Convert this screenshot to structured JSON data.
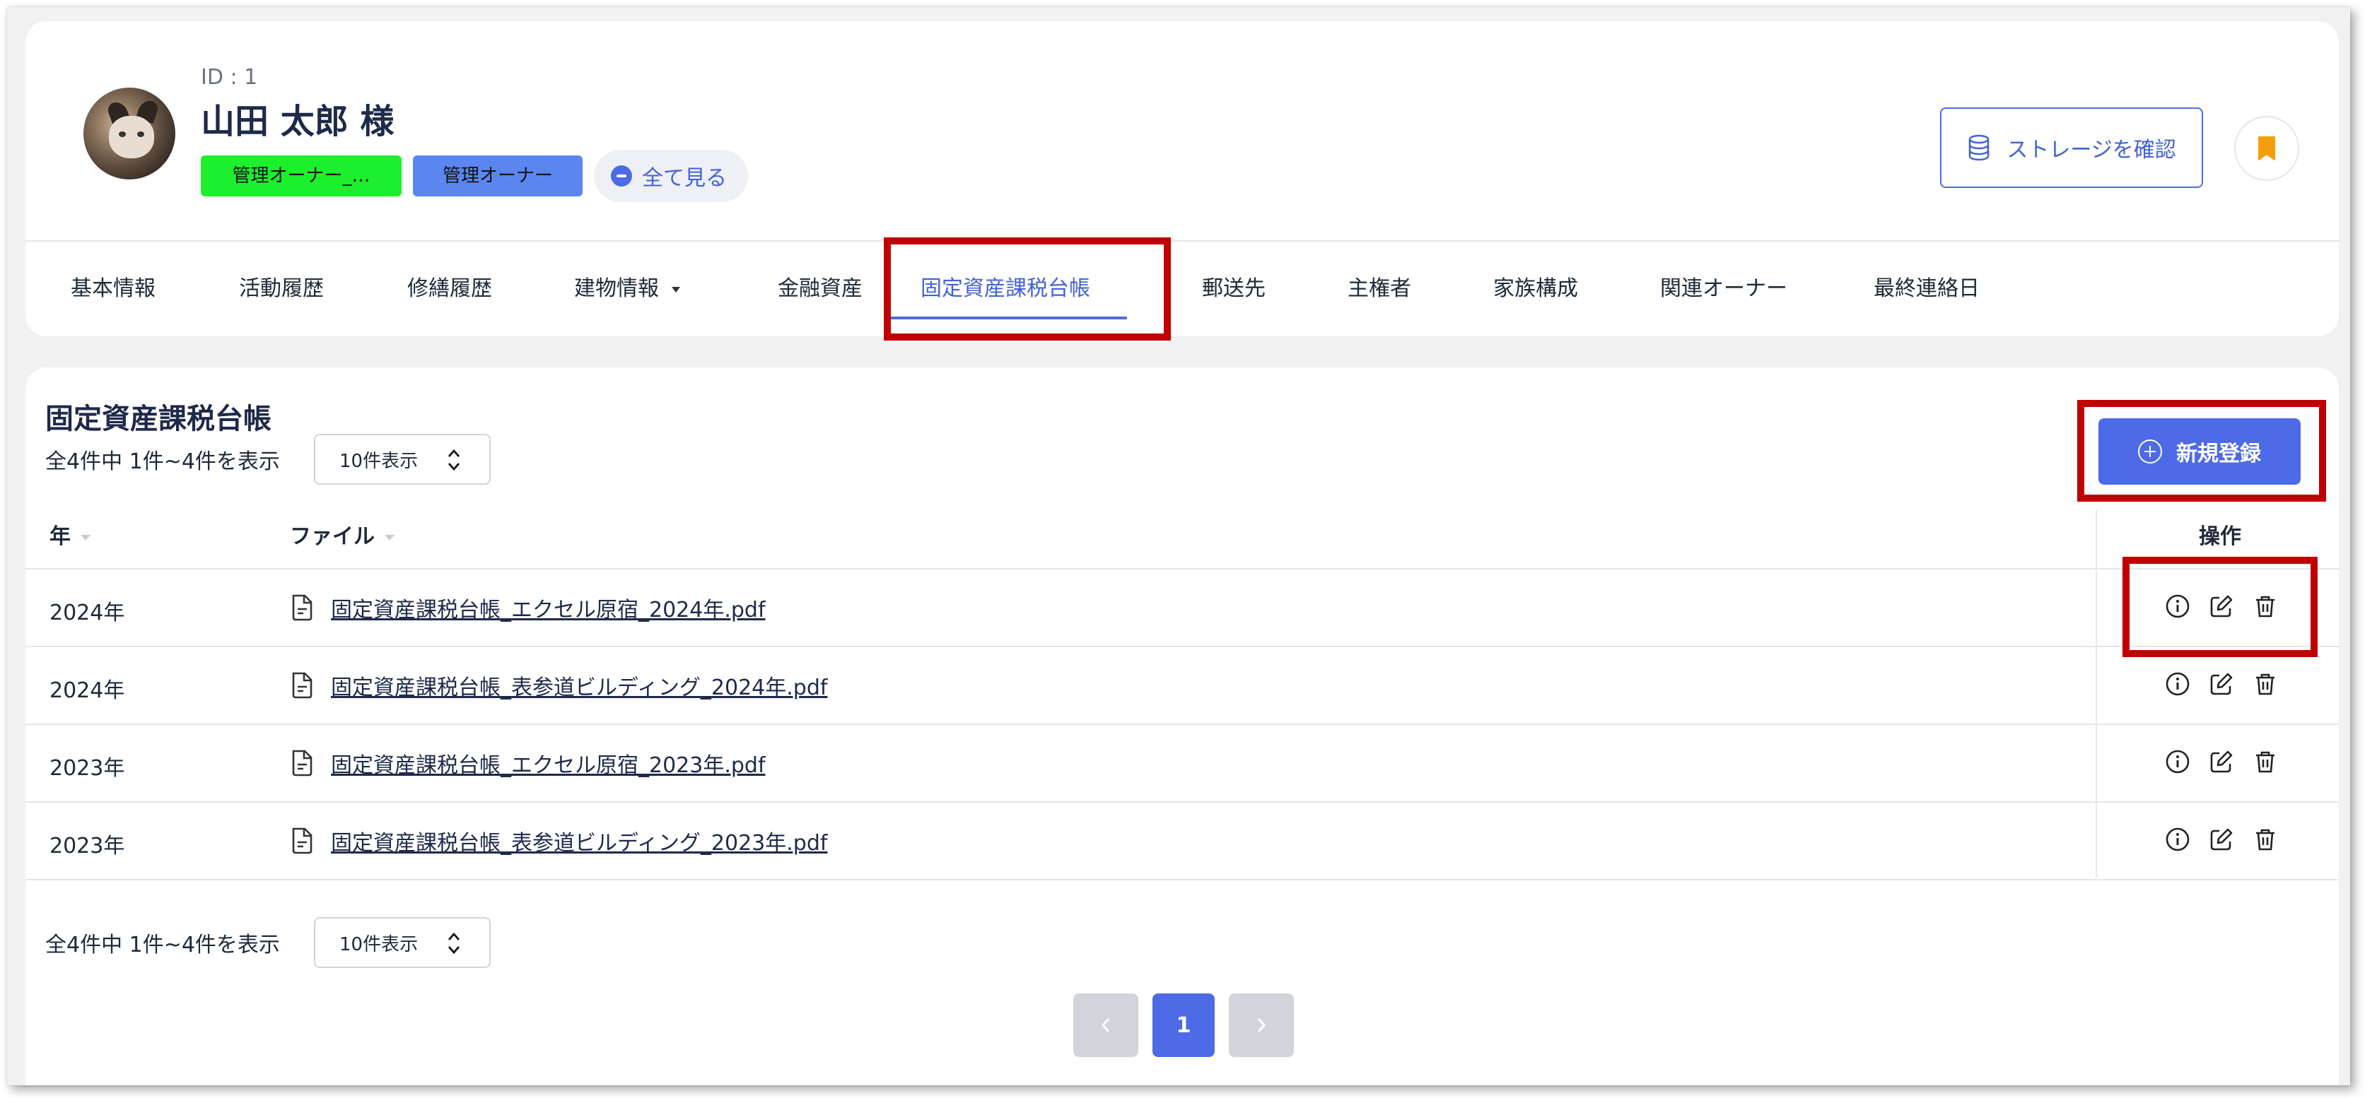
{
  "owner": {
    "id_label": "ID : 1",
    "name": "山田 太郎 様",
    "tags": [
      "管理オーナー_…",
      "管理オーナー"
    ],
    "see_all_label": "全て見る"
  },
  "actions": {
    "storage_label": "ストレージを確認"
  },
  "tabs": [
    {
      "label": "基本情報"
    },
    {
      "label": "活動履歴"
    },
    {
      "label": "修繕履歴"
    },
    {
      "label": "建物情報"
    },
    {
      "label": "金融資産"
    },
    {
      "label": "固定資産課税台帳",
      "active": true
    },
    {
      "label": "郵送先"
    },
    {
      "label": "主権者"
    },
    {
      "label": "家族構成"
    },
    {
      "label": "関連オーナー"
    },
    {
      "label": "最終連絡日"
    }
  ],
  "section": {
    "title": "固定資産課税台帳",
    "count_text": "全4件中 1件~4件を表示",
    "page_size": "10件表示",
    "new_label": "新規登録"
  },
  "table": {
    "headers": {
      "year": "年",
      "file": "ファイル",
      "ops": "操作"
    },
    "rows": [
      {
        "year": "2024年",
        "file": "固定資産課税台帳_エクセル原宿_2024年.pdf"
      },
      {
        "year": "2024年",
        "file": "固定資産課税台帳_表参道ビルディング_2024年.pdf"
      },
      {
        "year": "2023年",
        "file": "固定資産課税台帳_エクセル原宿_2023年.pdf"
      },
      {
        "year": "2023年",
        "file": "固定資産課税台帳_表参道ビルディング_2023年.pdf"
      }
    ]
  },
  "footer": {
    "count_text": "全4件中 1件~4件を表示",
    "page_size": "10件表示",
    "current_page": "1"
  },
  "colors": {
    "accent": "#4d6be6",
    "highlight": "#c00000",
    "tag_green": "#1cf02c",
    "tag_blue": "#5b86f0"
  }
}
